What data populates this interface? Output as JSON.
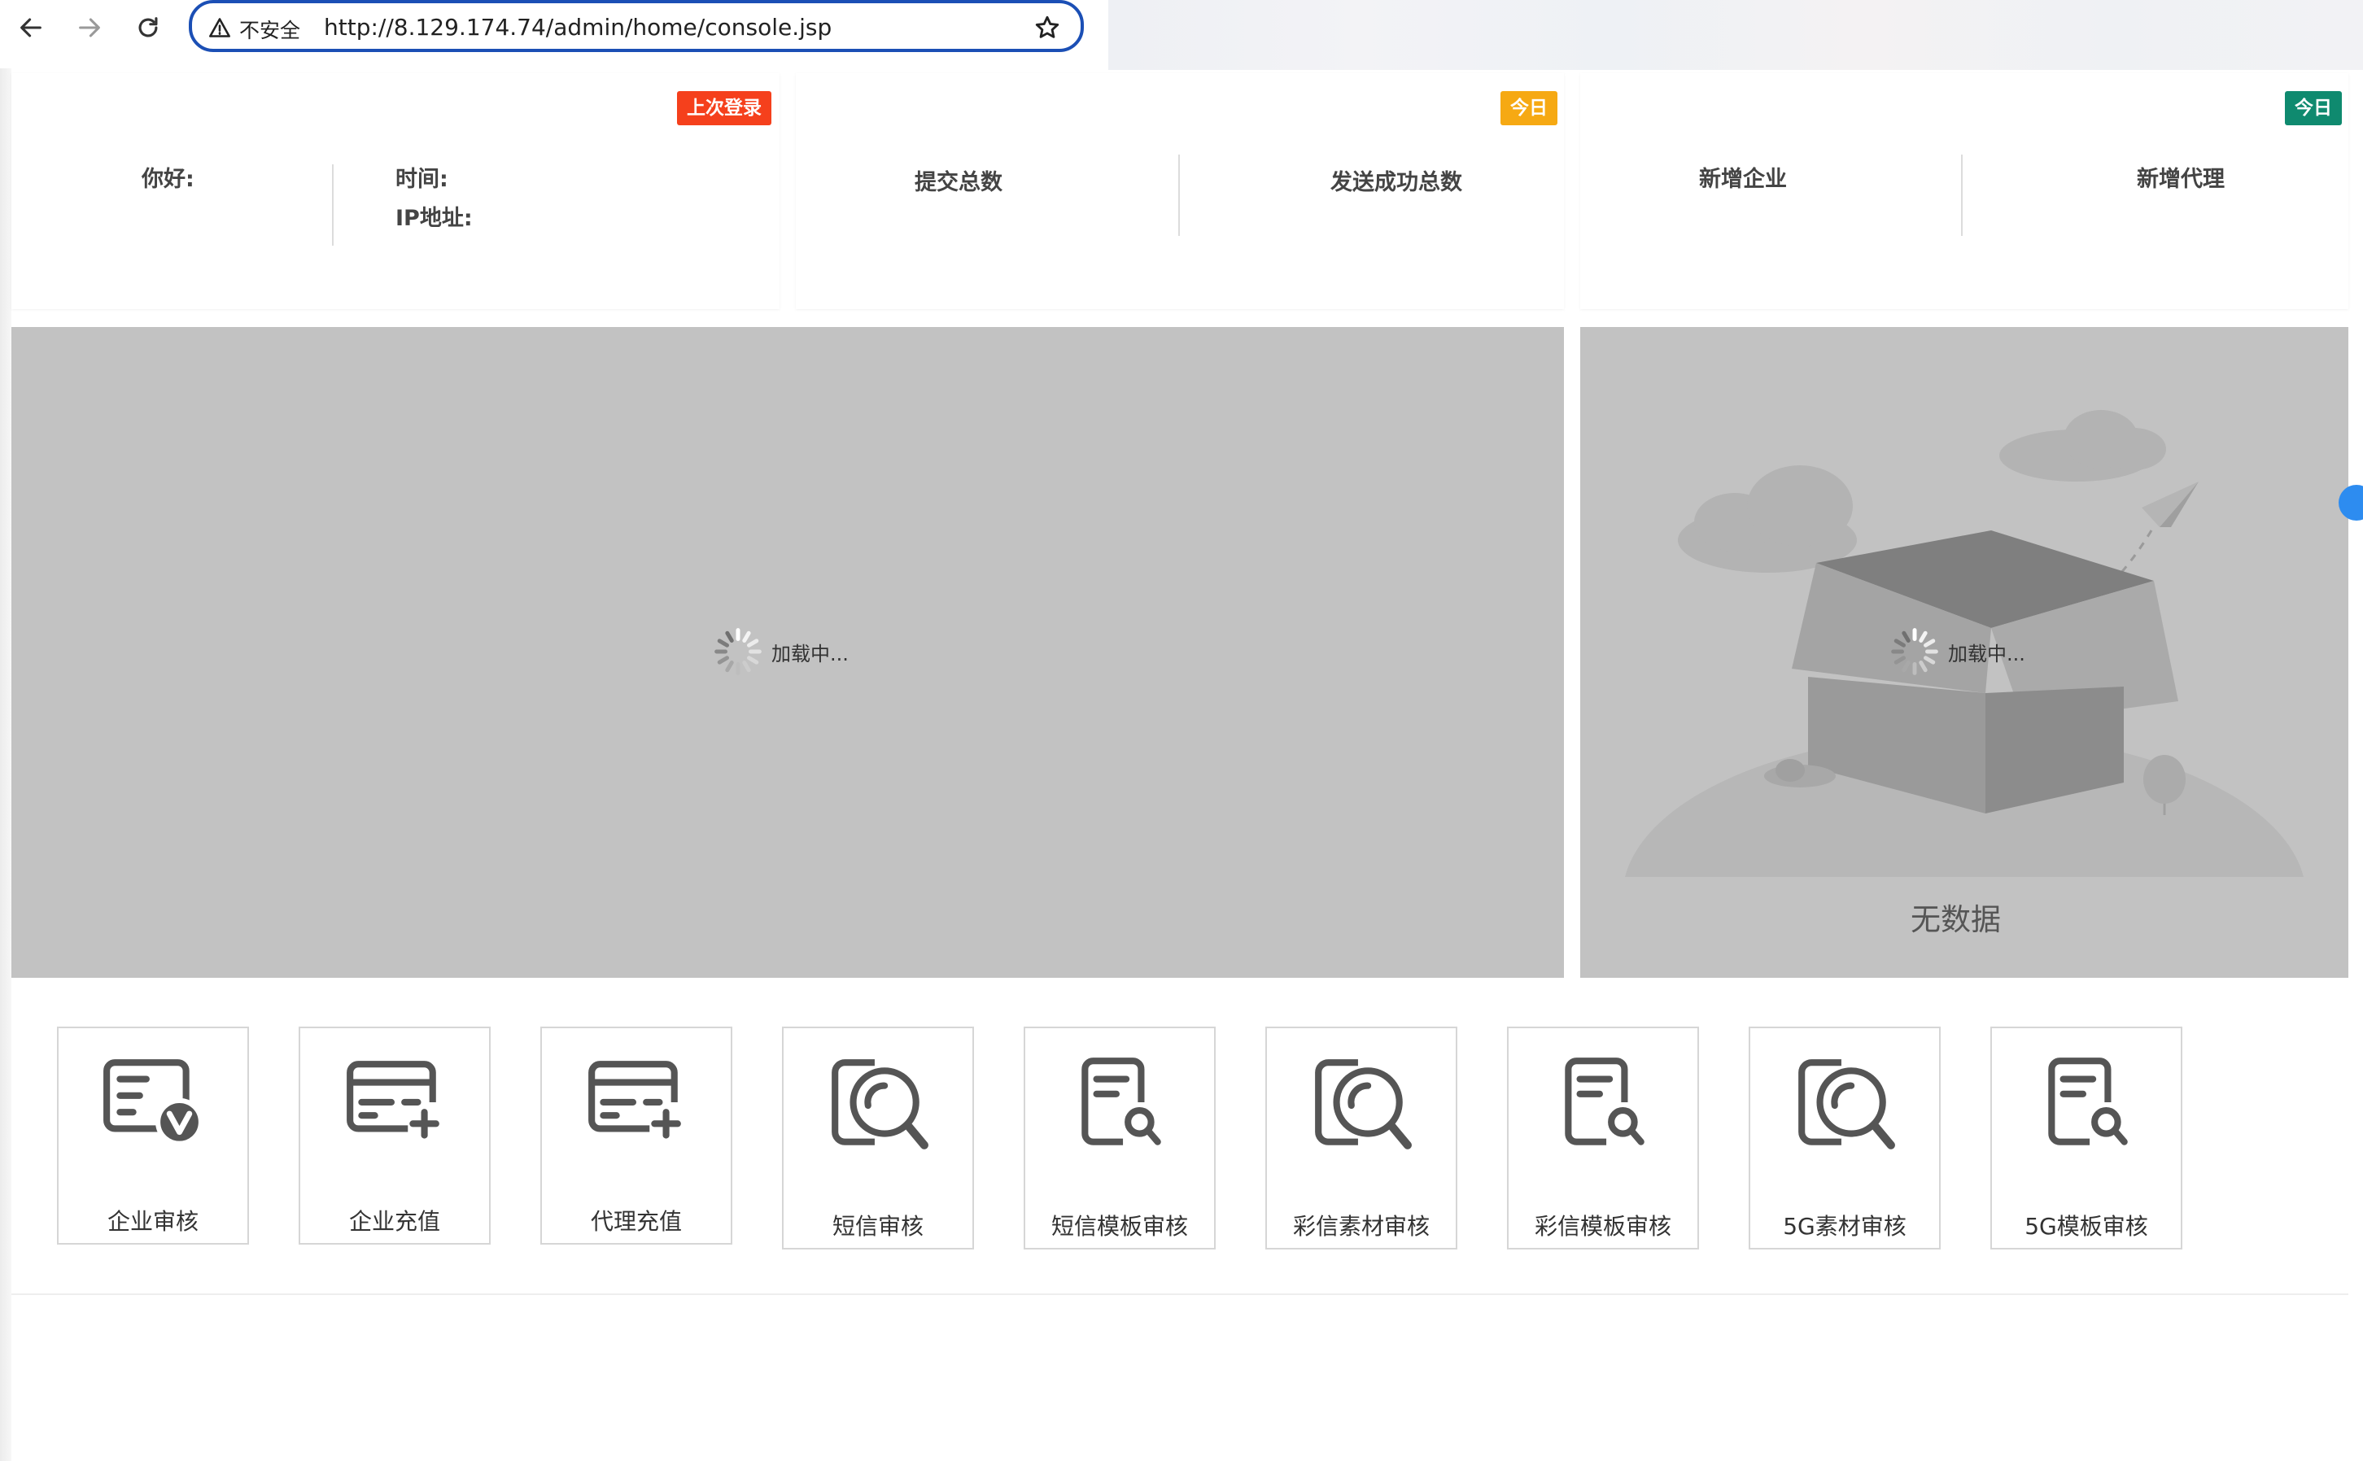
{
  "browser": {
    "security_label": "不安全",
    "url": "http://8.129.174.74/admin/home/console.jsp"
  },
  "cards": {
    "login": {
      "badge": "上次登录",
      "badge_color": "#f5401c",
      "hello": "你好:",
      "time": "时间:",
      "ip": "IP地址:"
    },
    "sms": {
      "badge": "今日",
      "badge_color": "#f6a913",
      "submitted": "提交总数",
      "sent_success": "发送成功总数"
    },
    "growth": {
      "badge": "今日",
      "badge_color": "#0f8a6f",
      "new_enterprise": "新增企业",
      "new_agent": "新增代理"
    }
  },
  "panels": {
    "loading_text": "加载中...",
    "empty_text": "无数据",
    "overlay_color": "#c2c2c2"
  },
  "tiles": [
    {
      "label": "企业审核",
      "icon": "enterprise-verify-icon"
    },
    {
      "label": "企业充值",
      "icon": "card-add-icon"
    },
    {
      "label": "代理充值",
      "icon": "card-add-icon"
    },
    {
      "label": "短信审核",
      "icon": "search-frame-icon"
    },
    {
      "label": "短信模板审核",
      "icon": "doc-search-icon"
    },
    {
      "label": "彩信素材审核",
      "icon": "search-frame-icon"
    },
    {
      "label": "彩信模板审核",
      "icon": "doc-search-icon"
    },
    {
      "label": "5G素材审核",
      "icon": "search-frame-icon"
    },
    {
      "label": "5G模板审核",
      "icon": "doc-search-icon"
    }
  ]
}
